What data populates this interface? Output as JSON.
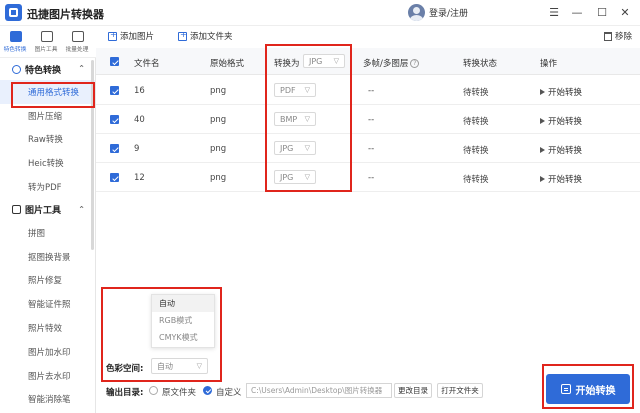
{
  "window": {
    "title": "迅捷图片转换器",
    "login": "登录/注册",
    "controls": [
      "☰",
      "—",
      "☐",
      "✕"
    ]
  },
  "rail": {
    "items": [
      "特色转换",
      "图片工具",
      "批量处理"
    ]
  },
  "sidebar": {
    "section1": "特色转换",
    "items1": [
      "通用格式转换",
      "图片压缩",
      "Raw转换",
      "Heic转换",
      "转为PDF"
    ],
    "section2": "图片工具",
    "items2": [
      "拼图",
      "抠图换背景",
      "照片修复",
      "智能证件照",
      "照片特效",
      "图片加水印",
      "图片去水印",
      "智能消除笔"
    ]
  },
  "toolbar": {
    "add_image": "添加图片",
    "add_folder": "添加文件夹",
    "remove": "移除"
  },
  "table": {
    "headers": {
      "filename": "文件名",
      "orig_format": "原始格式",
      "convert_to": "转换为",
      "convert_to_value": "JPG",
      "multi_frame": "多帧/多图层",
      "status": "转换状态",
      "action": "操作"
    },
    "rows": [
      {
        "name": "16",
        "format": "png",
        "target": "PDF",
        "frames": "--",
        "status": "待转换",
        "action": "开始转换"
      },
      {
        "name": "40",
        "format": "png",
        "target": "BMP",
        "frames": "--",
        "status": "待转换",
        "action": "开始转换"
      },
      {
        "name": "9",
        "format": "png",
        "target": "JPG",
        "frames": "--",
        "status": "待转换",
        "action": "开始转换"
      },
      {
        "name": "12",
        "format": "png",
        "target": "JPG",
        "frames": "--",
        "status": "待转换",
        "action": "开始转换"
      }
    ]
  },
  "color_space": {
    "label": "色彩空间:",
    "value": "自动",
    "options": [
      "自动",
      "RGB模式",
      "CMYK模式"
    ]
  },
  "output": {
    "label": "输出目录:",
    "option_source": "原文件夹",
    "option_custom": "自定义",
    "path": "C:\\Users\\Admin\\Desktop\\图片转换器",
    "change_dir": "更改目录",
    "open_folder": "打开文件夹"
  },
  "start_all": "开始转换",
  "colors": {
    "accent": "#2f6bd8",
    "highlight": "#e0251c"
  }
}
